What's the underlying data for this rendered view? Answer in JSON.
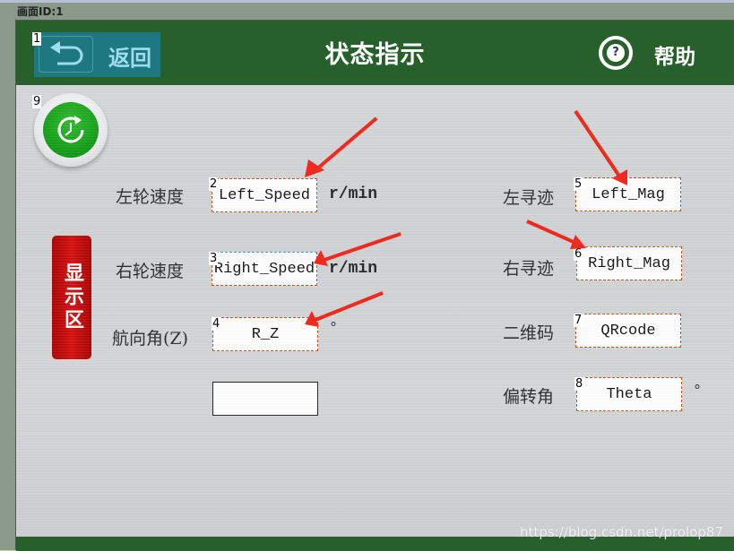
{
  "window": {
    "screen_id_label": "画面ID:1"
  },
  "header": {
    "title": "状态指示",
    "back_button": {
      "label": "返回",
      "tag": "1"
    },
    "help_button": {
      "label": "帮助",
      "icon_glyph": "?"
    }
  },
  "refresh_button": {
    "tag": "9",
    "icon": "clock-refresh-icon"
  },
  "display_zone": {
    "label": "显示区"
  },
  "left_fields": [
    {
      "label": "左轮速度",
      "value": "Left_Speed",
      "tag": "2",
      "unit": "r/min"
    },
    {
      "label": "右轮速度",
      "value": "Right_Speed",
      "tag": "3",
      "unit": "r/min"
    },
    {
      "label": "航向角(Z)",
      "value": "R_Z",
      "tag": "4",
      "unit": "°"
    },
    {
      "label": "",
      "value": "",
      "tag": "",
      "unit": ""
    }
  ],
  "right_fields": [
    {
      "label": "左寻迹",
      "value": "Left_Mag",
      "tag": "5",
      "unit": ""
    },
    {
      "label": "右寻迹",
      "value": "Right_Mag",
      "tag": "6",
      "unit": ""
    },
    {
      "label": "二维码",
      "value": "QRcode",
      "tag": "7",
      "unit": ""
    },
    {
      "label": "偏转角",
      "value": "Theta",
      "tag": "8",
      "unit": "°"
    }
  ],
  "watermark": "https://blog.csdn.net/prolop87",
  "colors": {
    "header_green": "#27602a",
    "back_button_teal": "#1d7880",
    "display_zone_red": "#c80a0a",
    "refresh_green": "#0f9a12",
    "annotation_arrow": "#f02a1e"
  }
}
